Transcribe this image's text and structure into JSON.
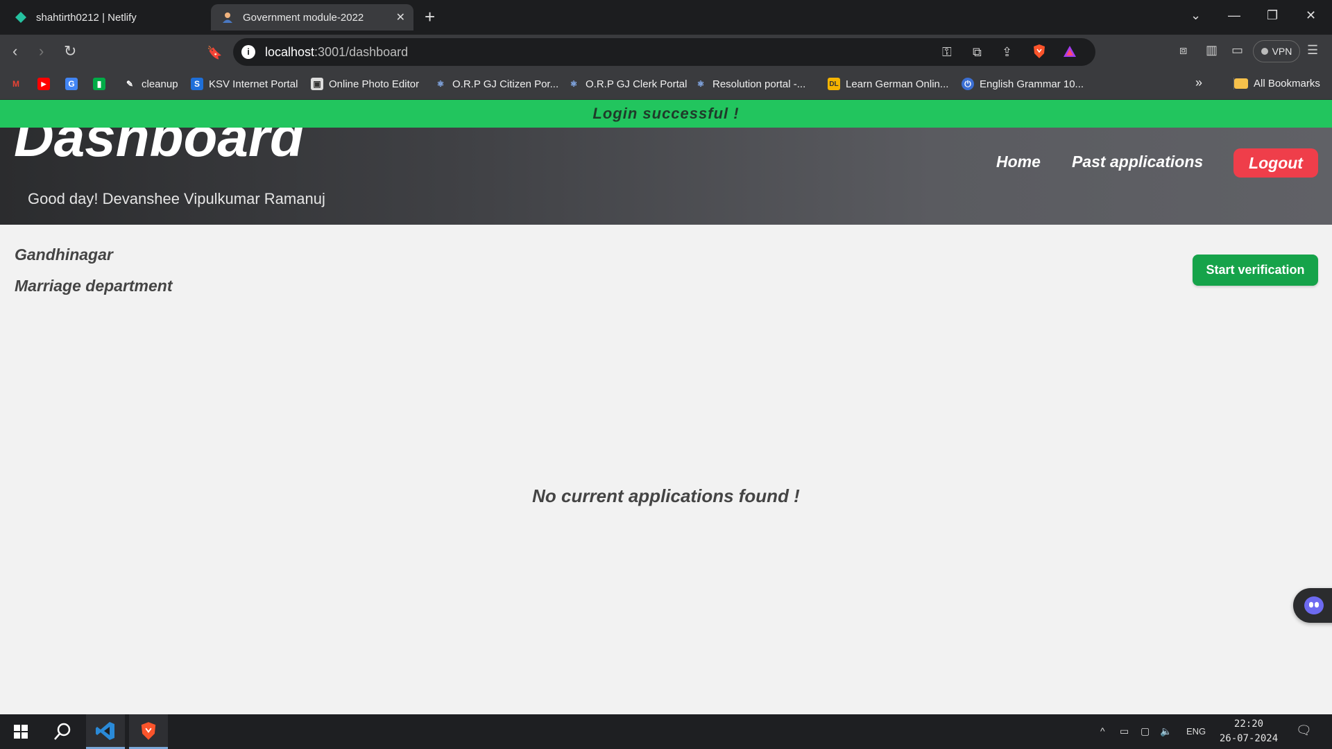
{
  "browser": {
    "tabs": [
      {
        "title": "shahtirth0212 | Netlify",
        "favicon": "netlify-diamond-icon",
        "active": false
      },
      {
        "title": "Government module-2022",
        "favicon": "person-icon",
        "active": true
      }
    ],
    "url_host": "localhost",
    "url_path": ":3001/dashboard",
    "vpn_label": "VPN",
    "bookmarks": [
      {
        "label": "",
        "icon": "gmail-icon"
      },
      {
        "label": "",
        "icon": "youtube-icon"
      },
      {
        "label": "",
        "icon": "translate-icon"
      },
      {
        "label": "",
        "icon": "meet-icon"
      },
      {
        "label": "cleanup",
        "icon": "cleanup-icon"
      },
      {
        "label": "KSV Internet Portal",
        "icon": "ksv-icon"
      },
      {
        "label": "Online Photo Editor",
        "icon": "photo-icon"
      },
      {
        "label": "O.R.P GJ Citizen Por...",
        "icon": "react-icon"
      },
      {
        "label": "O.R.P GJ Clerk Portal",
        "icon": "react-icon"
      },
      {
        "label": "Resolution portal -...",
        "icon": "react-icon"
      },
      {
        "label": "Learn German Onlin...",
        "icon": "dl-icon"
      },
      {
        "label": "English Grammar 10...",
        "icon": "power-icon"
      }
    ],
    "all_bookmarks": "All Bookmarks"
  },
  "toast": "Login  successful  !",
  "header": {
    "title": "Dashboard",
    "greeting": "Good day! Devanshee Vipulkumar Ramanuj",
    "nav_home": "Home",
    "nav_past": "Past applications",
    "logout": "Logout"
  },
  "main": {
    "city": "Gandhinagar",
    "department": "Marriage department",
    "start_button": "Start verification",
    "empty_message": "No current applications found !"
  },
  "taskbar": {
    "lang": "ENG",
    "time": "22:20",
    "date": "26-07-2024"
  },
  "colors": {
    "toast_bg": "#22c55e",
    "logout_bg": "#ef3e4a",
    "start_bg": "#16a34a"
  }
}
